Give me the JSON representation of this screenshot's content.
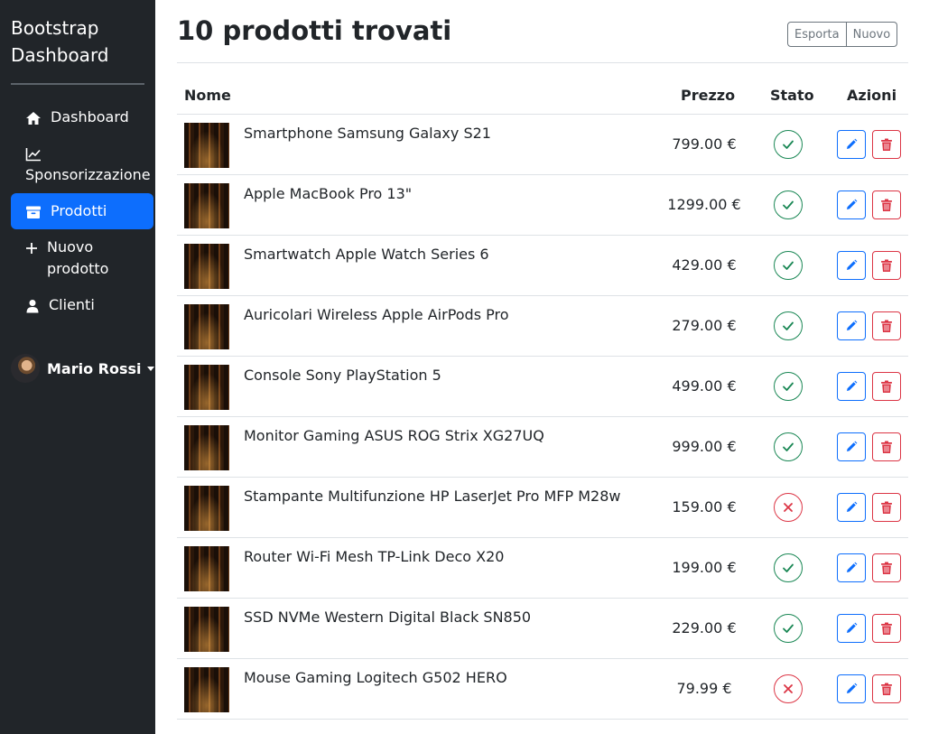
{
  "sidebar": {
    "brand": "Bootstrap Dashboard",
    "items": [
      {
        "label": "Dashboard",
        "icon": "home-icon"
      },
      {
        "label": "Sponsorizzazione",
        "icon": "chart-line-icon"
      },
      {
        "label": "Prodotti",
        "icon": "archive-icon",
        "active": true
      },
      {
        "label": "Nuovo prodotto",
        "icon": "plus-icon"
      },
      {
        "label": "Clienti",
        "icon": "user-icon"
      }
    ],
    "user": {
      "name": "Mario Rossi"
    }
  },
  "header": {
    "title": "10 prodotti trovati",
    "export_label": "Esporta",
    "new_label": "Nuovo"
  },
  "table": {
    "columns": [
      "Nome",
      "Prezzo",
      "Stato",
      "Azioni"
    ],
    "rows": [
      {
        "name": "Smartphone Samsung Galaxy S21",
        "price": "799.00 €",
        "status": "active"
      },
      {
        "name": "Apple MacBook Pro 13\"",
        "price": "1299.00 €",
        "status": "active"
      },
      {
        "name": "Smartwatch Apple Watch Series 6",
        "price": "429.00 €",
        "status": "active"
      },
      {
        "name": "Auricolari Wireless Apple AirPods Pro",
        "price": "279.00 €",
        "status": "active"
      },
      {
        "name": "Console Sony PlayStation 5",
        "price": "499.00 €",
        "status": "active"
      },
      {
        "name": "Monitor Gaming ASUS ROG Strix XG27UQ",
        "price": "999.00 €",
        "status": "active"
      },
      {
        "name": "Stampante Multifunzione HP LaserJet Pro MFP M28w",
        "price": "159.00 €",
        "status": "inactive"
      },
      {
        "name": "Router Wi-Fi Mesh TP-Link Deco X20",
        "price": "199.00 €",
        "status": "active"
      },
      {
        "name": "SSD NVMe Western Digital Black SN850",
        "price": "229.00 €",
        "status": "active"
      },
      {
        "name": "Mouse Gaming Logitech G502 HERO",
        "price": "79.99 €",
        "status": "inactive"
      }
    ]
  },
  "colors": {
    "sidebar_bg": "#212529",
    "accent": "#0d6efd",
    "success": "#198754",
    "danger": "#dc3545"
  }
}
